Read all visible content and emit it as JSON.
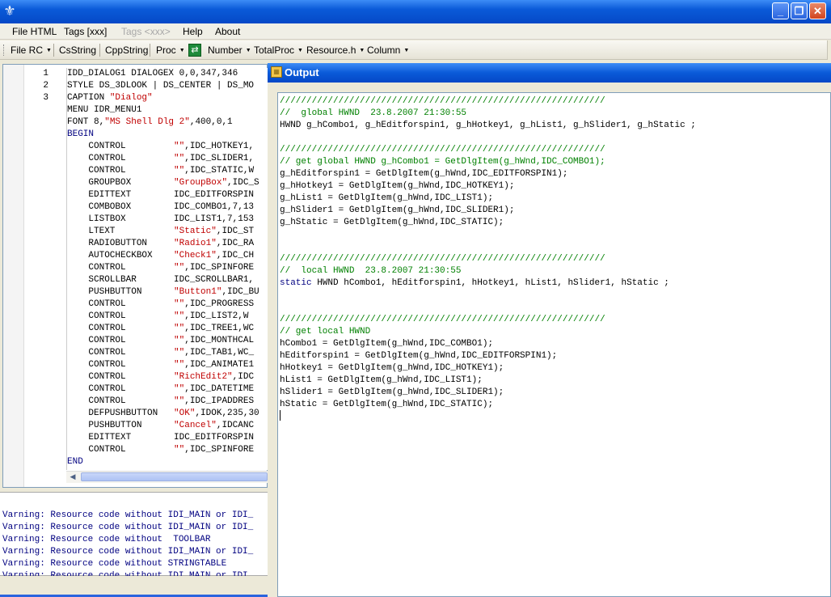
{
  "window": {
    "icon": "fleur-de-lis-icon",
    "buttons": {
      "minimize": "_",
      "maximize": "❐",
      "close": "✕"
    }
  },
  "menubar": {
    "items": [
      {
        "label": "File HTML",
        "disabled": false
      },
      {
        "label": "Tags [xxx]",
        "disabled": false
      },
      {
        "label": "Tags <xxx>",
        "disabled": true
      },
      {
        "label": "Help",
        "disabled": false
      },
      {
        "label": "About",
        "disabled": false
      }
    ]
  },
  "toolbar": {
    "file_rc": "File RC",
    "csstring": "CsString",
    "cppstring": "CppString",
    "proc": "Proc",
    "number": "Number",
    "totalproc": "TotalProc",
    "resource_h": "Resource.h",
    "column": "Column",
    "icon": "swap-icon"
  },
  "editor": {
    "line_numbers": [
      "1",
      "2",
      "3"
    ],
    "lines": [
      [
        {
          "t": "IDD_DIALOG1 DIALOGEX 0,0,347,346"
        }
      ],
      [
        {
          "t": "STYLE DS_3DLOOK | DS_CENTER | DS_MO"
        }
      ],
      [
        {
          "t": "CAPTION "
        },
        {
          "t": "\"Dialog\"",
          "c": "str"
        }
      ],
      [
        {
          "t": "MENU IDR_MENU1"
        }
      ],
      [
        {
          "t": "FONT 8,"
        },
        {
          "t": "\"MS Shell Dlg 2\"",
          "c": "str"
        },
        {
          "t": ",400,0,1"
        }
      ],
      [
        {
          "t": "BEGIN",
          "c": "kw"
        }
      ],
      [
        {
          "t": "    CONTROL         "
        },
        {
          "t": "\"\"",
          "c": "str"
        },
        {
          "t": ",IDC_HOTKEY1,"
        }
      ],
      [
        {
          "t": "    CONTROL         "
        },
        {
          "t": "\"\"",
          "c": "str"
        },
        {
          "t": ",IDC_SLIDER1,"
        }
      ],
      [
        {
          "t": "    CONTROL         "
        },
        {
          "t": "\"\"",
          "c": "str"
        },
        {
          "t": ",IDC_STATIC,W"
        }
      ],
      [
        {
          "t": "    GROUPBOX        "
        },
        {
          "t": "\"GroupBox\"",
          "c": "str"
        },
        {
          "t": ",IDC_S"
        }
      ],
      [
        {
          "t": "    EDITTEXT        IDC_EDITFORSPIN"
        }
      ],
      [
        {
          "t": "    COMBOBOX        IDC_COMBO1,7,13"
        }
      ],
      [
        {
          "t": "    LISTBOX         IDC_LIST1,7,153"
        }
      ],
      [
        {
          "t": "    LTEXT           "
        },
        {
          "t": "\"Static\"",
          "c": "str"
        },
        {
          "t": ",IDC_ST"
        }
      ],
      [
        {
          "t": "    RADIOBUTTON     "
        },
        {
          "t": "\"Radio1\"",
          "c": "str"
        },
        {
          "t": ",IDC_RA"
        }
      ],
      [
        {
          "t": "    AUTOCHECKBOX    "
        },
        {
          "t": "\"Check1\"",
          "c": "str"
        },
        {
          "t": ",IDC_CH"
        }
      ],
      [
        {
          "t": "    CONTROL         "
        },
        {
          "t": "\"\"",
          "c": "str"
        },
        {
          "t": ",IDC_SPINFORE"
        }
      ],
      [
        {
          "t": "    SCROLLBAR       IDC_SCROLLBAR1,"
        }
      ],
      [
        {
          "t": "    PUSHBUTTON      "
        },
        {
          "t": "\"Button1\"",
          "c": "str"
        },
        {
          "t": ",IDC_BU"
        }
      ],
      [
        {
          "t": "    CONTROL         "
        },
        {
          "t": "\"\"",
          "c": "str"
        },
        {
          "t": ",IDC_PROGRESS"
        }
      ],
      [
        {
          "t": "    CONTROL         "
        },
        {
          "t": "\"\"",
          "c": "str"
        },
        {
          "t": ",IDC_LIST2,W"
        }
      ],
      [
        {
          "t": "    CONTROL         "
        },
        {
          "t": "\"\"",
          "c": "str"
        },
        {
          "t": ",IDC_TREE1,WC"
        }
      ],
      [
        {
          "t": "    CONTROL         "
        },
        {
          "t": "\"\"",
          "c": "str"
        },
        {
          "t": ",IDC_MONTHCAL"
        }
      ],
      [
        {
          "t": "    CONTROL         "
        },
        {
          "t": "\"\"",
          "c": "str"
        },
        {
          "t": ",IDC_TAB1,WC_"
        }
      ],
      [
        {
          "t": "    CONTROL         "
        },
        {
          "t": "\"\"",
          "c": "str"
        },
        {
          "t": ",IDC_ANIMATE1"
        }
      ],
      [
        {
          "t": "    CONTROL         "
        },
        {
          "t": "\"RichEdit2\"",
          "c": "str"
        },
        {
          "t": ",IDC"
        }
      ],
      [
        {
          "t": "    CONTROL         "
        },
        {
          "t": "\"\"",
          "c": "str"
        },
        {
          "t": ",IDC_DATETIME"
        }
      ],
      [
        {
          "t": "    CONTROL         "
        },
        {
          "t": "\"\"",
          "c": "str"
        },
        {
          "t": ",IDC_IPADDRES"
        }
      ],
      [
        {
          "t": "    DEFPUSHBUTTON   "
        },
        {
          "t": "\"OK\"",
          "c": "str"
        },
        {
          "t": ",IDOK,235,30"
        }
      ],
      [
        {
          "t": "    PUSHBUTTON      "
        },
        {
          "t": "\"Cancel\"",
          "c": "str"
        },
        {
          "t": ",IDCANC"
        }
      ],
      [
        {
          "t": "    EDITTEXT        IDC_EDITFORSPIN"
        }
      ],
      [
        {
          "t": "    CONTROL         "
        },
        {
          "t": "\"\"",
          "c": "str"
        },
        {
          "t": ",IDC_SPINFORE"
        }
      ],
      [
        {
          "t": "END",
          "c": "kw"
        }
      ]
    ]
  },
  "warnings": [
    "Varning: Resource code without IDI_MAIN or IDI_",
    "Varning: Resource code without IDI_MAIN or IDI_",
    "Varning: Resource code without  TOOLBAR",
    "Varning: Resource code without IDI_MAIN or IDI_",
    "Varning: Resource code without STRINGTABLE",
    "Varning: Resource code without IDI_MAIN or IDI_"
  ],
  "output": {
    "title": "Output",
    "icon": "output-window-icon",
    "lines": [
      [
        {
          "t": "/////////////////////////////////////////////////////////////",
          "c": "c-comment"
        }
      ],
      [
        {
          "t": "//  global HWND  23.8.2007 21:30:55",
          "c": "c-comment"
        }
      ],
      [
        {
          "t": "HWND g_hCombo1, g_hEditforspin1, g_hHotkey1, g_hList1, g_hSlider1, g_hStatic ;"
        }
      ],
      [
        {
          "t": ""
        }
      ],
      [
        {
          "t": "/////////////////////////////////////////////////////////////",
          "c": "c-comment"
        }
      ],
      [
        {
          "t": "// get global HWND g_hCombo1 = GetDlgItem(g_hWnd,IDC_COMBO1);",
          "c": "c-comment"
        }
      ],
      [
        {
          "t": "g_hEditforspin1 = GetDlgItem(g_hWnd,IDC_EDITFORSPIN1);"
        }
      ],
      [
        {
          "t": "g_hHotkey1 = GetDlgItem(g_hWnd,IDC_HOTKEY1);"
        }
      ],
      [
        {
          "t": "g_hList1 = GetDlgItem(g_hWnd,IDC_LIST1);"
        }
      ],
      [
        {
          "t": "g_hSlider1 = GetDlgItem(g_hWnd,IDC_SLIDER1);"
        }
      ],
      [
        {
          "t": "g_hStatic = GetDlgItem(g_hWnd,IDC_STATIC);"
        }
      ],
      [
        {
          "t": ""
        }
      ],
      [
        {
          "t": ""
        }
      ],
      [
        {
          "t": "/////////////////////////////////////////////////////////////",
          "c": "c-comment"
        }
      ],
      [
        {
          "t": "//  local HWND  23.8.2007 21:30:55",
          "c": "c-comment"
        }
      ],
      [
        {
          "t": "static",
          "c": "c-kw"
        },
        {
          "t": " HWND hCombo1, hEditforspin1, hHotkey1, hList1, hSlider1, hStatic ;"
        }
      ],
      [
        {
          "t": ""
        }
      ],
      [
        {
          "t": ""
        }
      ],
      [
        {
          "t": "/////////////////////////////////////////////////////////////",
          "c": "c-comment"
        }
      ],
      [
        {
          "t": "// get local HWND",
          "c": "c-comment"
        }
      ],
      [
        {
          "t": "hCombo1 = GetDlgItem(g_hWnd,IDC_COMBO1);"
        }
      ],
      [
        {
          "t": "hEditforspin1 = GetDlgItem(g_hWnd,IDC_EDITFORSPIN1);"
        }
      ],
      [
        {
          "t": "hHotkey1 = GetDlgItem(g_hWnd,IDC_HOTKEY1);"
        }
      ],
      [
        {
          "t": "hList1 = GetDlgItem(g_hWnd,IDC_LIST1);"
        }
      ],
      [
        {
          "t": "hSlider1 = GetDlgItem(g_hWnd,IDC_SLIDER1);"
        }
      ],
      [
        {
          "t": "hStatic = GetDlgItem(g_hWnd,IDC_STATIC);"
        }
      ]
    ]
  },
  "colors": {
    "titlebar": "#0a5ad8",
    "comment": "#008000",
    "string": "#c00000",
    "keyword": "#000080"
  }
}
